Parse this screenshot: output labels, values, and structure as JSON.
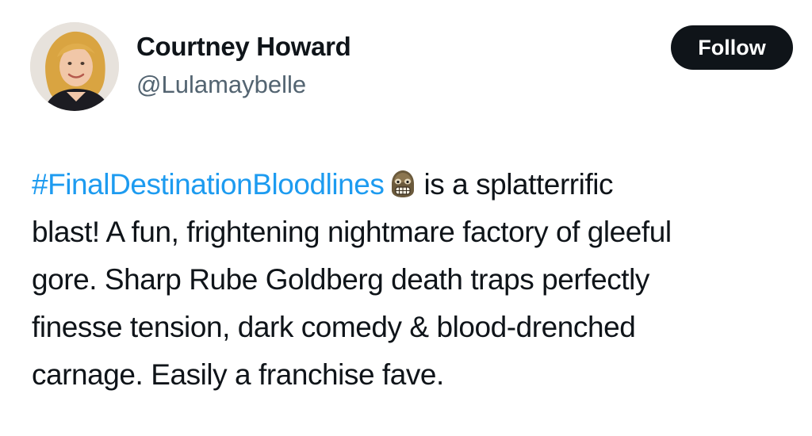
{
  "author": {
    "name": "Courtney Howard",
    "handle": "@Lulamaybelle"
  },
  "follow_button": {
    "label": "Follow"
  },
  "tweet": {
    "hashtag": "#FinalDestinationBloodlines",
    "emoji": "skull-face-icon",
    "line1_rest": "is a  splatterrific",
    "line2": "blast! A fun, frightening nightmare factory of gleeful",
    "line3": "gore. Sharp Rube Goldberg death traps perfectly",
    "line4": "finesse tension, dark comedy & blood-drenched",
    "line5": "carnage. Easily a franchise fave."
  },
  "colors": {
    "hashtag": "#1d9bf0",
    "handle": "#536471",
    "follow_bg": "#0f1419",
    "text": "#0f1419"
  }
}
